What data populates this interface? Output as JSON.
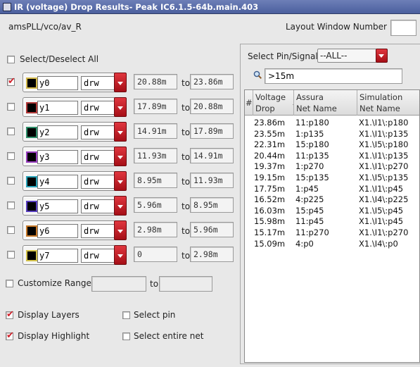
{
  "window": {
    "title": "IR (voltage) Drop Results- Peak IC6.1.5-64b.main.403"
  },
  "header": {
    "cell_path": "amsPLL/vco/av_R",
    "layout_window_label": "Layout Window Number",
    "layout_window_value": ""
  },
  "left": {
    "select_all_label": "Select/Deselect All",
    "to_label": "to",
    "layers": [
      {
        "name": "y0",
        "purpose": "drw",
        "from": "20.88m",
        "to": "23.86m",
        "checked": true,
        "color": "#d4b94a"
      },
      {
        "name": "y1",
        "purpose": "drw",
        "from": "17.89m",
        "to": "20.88m",
        "checked": false,
        "color": "#b33a3a"
      },
      {
        "name": "y2",
        "purpose": "drw",
        "from": "14.91m",
        "to": "17.89m",
        "checked": false,
        "color": "#2f8f6a"
      },
      {
        "name": "y3",
        "purpose": "drw",
        "from": "11.93m",
        "to": "14.91m",
        "checked": false,
        "color": "#9a3fc0"
      },
      {
        "name": "y4",
        "purpose": "drw",
        "from": "8.95m",
        "to": "11.93m",
        "checked": false,
        "color": "#2aa3b8"
      },
      {
        "name": "y5",
        "purpose": "drw",
        "from": "5.96m",
        "to": "8.95m",
        "checked": false,
        "color": "#5a3fc0"
      },
      {
        "name": "y6",
        "purpose": "drw",
        "from": "2.98m",
        "to": "5.96m",
        "checked": false,
        "color": "#c87a2a"
      },
      {
        "name": "y7",
        "purpose": "drw",
        "from": "0",
        "to": "2.98m",
        "checked": false,
        "color": "#d4c24a"
      }
    ],
    "customize_range_label": "Customize Range",
    "customize_to_label": "to",
    "display_layers_label": "Display Layers",
    "display_highlight_label": "Display Highlight",
    "select_pin_label": "Select pin",
    "select_entire_net_label": "Select entire net"
  },
  "right": {
    "select_signal_label": "Select Pin/Signal:",
    "select_signal_value": "--ALL--",
    "filter_value": ">15m",
    "columns": {
      "index": "#",
      "voltage_drop": [
        "Voltage",
        "Drop"
      ],
      "assura": [
        "Assura",
        "Net Name"
      ],
      "simulation": [
        "Simulation",
        "Net Name"
      ]
    },
    "rows": [
      {
        "drop": "23.86m",
        "assura": "11:p180",
        "sim": "X1.\\I1\\:p180"
      },
      {
        "drop": "23.55m",
        "assura": "1:p135",
        "sim": "X1.\\I1\\:p135"
      },
      {
        "drop": "22.31m",
        "assura": "15:p180",
        "sim": "X1.\\I5\\:p180"
      },
      {
        "drop": "20.44m",
        "assura": "11:p135",
        "sim": "X1.\\I1\\:p135"
      },
      {
        "drop": "19.37m",
        "assura": "1:p270",
        "sim": "X1.\\I1\\:p270"
      },
      {
        "drop": "19.15m",
        "assura": "15:p135",
        "sim": "X1.\\I5\\:p135"
      },
      {
        "drop": "17.75m",
        "assura": "1:p45",
        "sim": "X1.\\I1\\:p45"
      },
      {
        "drop": "16.52m",
        "assura": "4:p225",
        "sim": "X1.\\I4\\:p225"
      },
      {
        "drop": "16.03m",
        "assura": "15:p45",
        "sim": "X1.\\I5\\:p45"
      },
      {
        "drop": "15.98m",
        "assura": "11:p45",
        "sim": "X1.\\I1\\:p45"
      },
      {
        "drop": "15.17m",
        "assura": "11:p270",
        "sim": "X1.\\I1\\:p270"
      },
      {
        "drop": "15.09m",
        "assura": "4:p0",
        "sim": "X1.\\I4\\:p0"
      }
    ]
  }
}
